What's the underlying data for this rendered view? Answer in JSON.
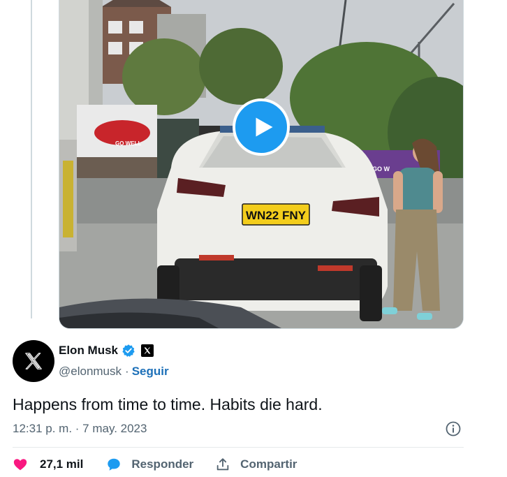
{
  "video": {
    "license_plate": "WN22 FNY",
    "billboard_text": "GO WELL",
    "sign_text": "GO W"
  },
  "author": {
    "display_name": "Elon Musk",
    "handle": "@elonmusk",
    "separator": "·",
    "follow_label": "Seguir"
  },
  "tweet": {
    "text": "Happens from time to time. Habits die hard.",
    "timestamp": "12:31 p. m. · 7 may. 2023"
  },
  "actions": {
    "like_count": "27,1 mil",
    "reply_label": "Responder",
    "share_label": "Compartir"
  },
  "colors": {
    "accent": "#1d9bf0",
    "like": "#f91880",
    "follow": "#1d70b8",
    "muted_text": "#536471"
  },
  "icons": [
    "play-icon",
    "x-logo-icon",
    "verified-badge-icon",
    "x-affiliate-badge-icon",
    "info-icon",
    "heart-icon",
    "reply-bubble-icon",
    "share-icon"
  ]
}
